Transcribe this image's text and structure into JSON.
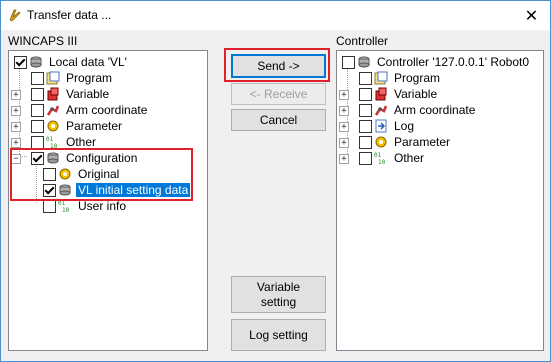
{
  "window": {
    "title": "Transfer data ..."
  },
  "left": {
    "group_label": "WINCAPS III",
    "root": "Local data 'VL'",
    "items": [
      "Program",
      "Variable",
      "Arm coordinate",
      "Parameter",
      "Other",
      "Configuration"
    ],
    "config_children": [
      "Original",
      "VL initial setting data",
      "User info"
    ]
  },
  "right": {
    "group_label": "Controller",
    "root": "Controller '127.0.0.1' Robot0",
    "items": [
      "Program",
      "Variable",
      "Arm coordinate",
      "Log",
      "Parameter",
      "Other"
    ]
  },
  "buttons": {
    "send": "Send ->",
    "receive": "<- Receive",
    "cancel": "Cancel",
    "variable_setting_line1": "Variable",
    "variable_setting_line2": "setting",
    "log_setting": "Log setting"
  },
  "colors": {
    "highlight": "#e0202a",
    "selection": "#0078d7"
  }
}
